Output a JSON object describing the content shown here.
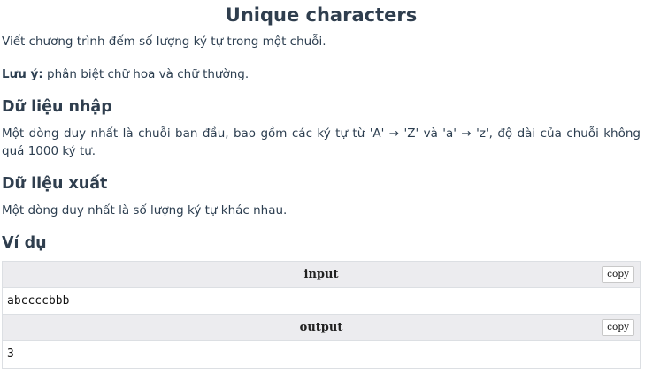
{
  "problem": {
    "title": "Unique characters",
    "intro": "Viết chương trình đếm số lượng ký tự trong một chuỗi.",
    "note_label": "Lưu ý:",
    "note_text": " phân biệt chữ hoa và chữ thường."
  },
  "sections": {
    "input_heading": "Dữ liệu nhập",
    "input_text": "Một dòng duy nhất là chuỗi ban đầu, bao gồm các ký tự từ 'A' → 'Z' và 'a' → 'z', độ dài của chuỗi không quá 1000 ký tự.",
    "output_heading": "Dữ liệu xuất",
    "output_text": "Một dòng duy nhất là số lượng ký tự khác nhau.",
    "example_heading": "Ví dụ"
  },
  "example": {
    "input_label": "input",
    "input_value": "abccccbbb",
    "output_label": "output",
    "output_value": "3",
    "copy_label": "copy"
  }
}
